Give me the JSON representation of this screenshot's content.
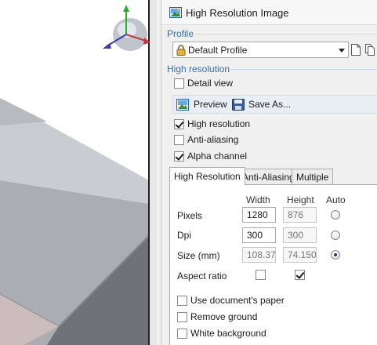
{
  "panel": {
    "title": "High Resolution Image",
    "profile_section": "Profile",
    "profile_value": "Default Profile",
    "hires_section": "High resolution",
    "detail_view_label": "Detail view",
    "preview_label": "Preview",
    "save_as_label": "Save As...",
    "options": [
      {
        "label": "High resolution",
        "checked": true
      },
      {
        "label": "Anti-aliasing",
        "checked": false
      },
      {
        "label": "Alpha channel",
        "checked": true
      }
    ],
    "tabs": [
      "High Resolution",
      "Anti-Aliasing",
      "Multiple"
    ],
    "active_tab": "High Resolution",
    "columns": {
      "width": "Width",
      "height": "Height",
      "auto": "Auto"
    },
    "rows": {
      "pixels": {
        "label": "Pixels",
        "width": "1280",
        "height": "876"
      },
      "dpi": {
        "label": "Dpi",
        "width": "300",
        "height": "300"
      },
      "size": {
        "label": "Size (mm)",
        "width": "108.37",
        "height": "74.150"
      }
    },
    "auto_selected": "size",
    "aspect_ratio": {
      "label": "Aspect ratio",
      "width_checked": false,
      "height_checked": true
    },
    "extra_options": [
      {
        "label": "Use document's paper",
        "checked": false
      },
      {
        "label": "Remove ground",
        "checked": false
      },
      {
        "label": "White background",
        "checked": false
      }
    ]
  },
  "colors": {
    "section_blue": "#3a6ea5",
    "toolbar_bg": "#e9eef5",
    "viewport_surface": "#a9adb1",
    "viewport_dark": "#6b6e72",
    "viewport_pink": "#c9b8ba"
  },
  "icons": {
    "title": "image-picture-icon",
    "lock": "lock-icon",
    "new_profile": "new-document-icon",
    "copy_profile": "copy-document-icon",
    "preview": "picture-icon",
    "save": "floppy-disk-icon",
    "gizmo": "axis-orientation-gizmo-icon"
  }
}
